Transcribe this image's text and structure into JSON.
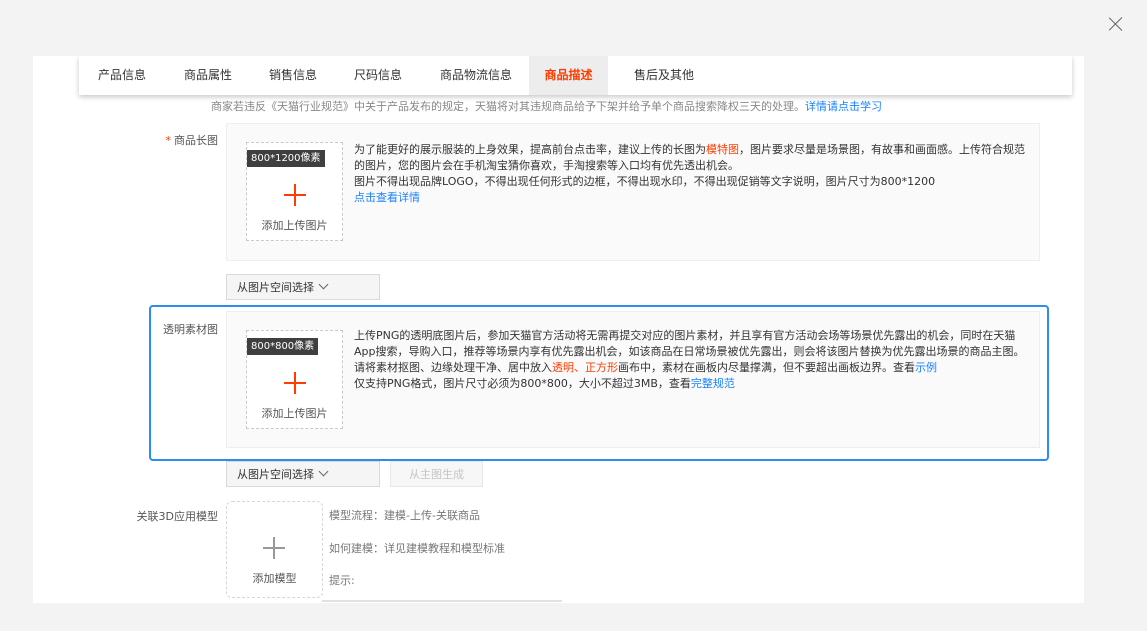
{
  "window": {
    "close_icon": "close-icon"
  },
  "tabs": [
    {
      "label": "产品信息",
      "active": false
    },
    {
      "label": "商品属性",
      "active": false
    },
    {
      "label": "销售信息",
      "active": false
    },
    {
      "label": "尺码信息",
      "active": false
    },
    {
      "label": "商品物流信息",
      "active": false
    },
    {
      "label": "商品描述",
      "active": true
    },
    {
      "label": "售后及其他",
      "active": false
    }
  ],
  "notice": {
    "text": "商家若违反《天猫行业规范》中关于产品发布的规定，天猫将对其违规商品给予下架并给予单个商品搜索降权三天的处理。",
    "link": "详情请点击学习"
  },
  "long_image": {
    "required_mark": "*",
    "label": "商品长图",
    "size_badge": "800*1200像素",
    "upload_label": "添加上传图片",
    "desc_part1": "为了能更好的展示服装的上身效果，提高前台点击率，建议上传的长图为",
    "desc_highlight": "模特图",
    "desc_part2": "，图片要求尽量是场景图，有故事和画面感。上传符合规范的图片，您的图片会在手机淘宝猜你喜欢，手淘搜索等入口均有优先透出机会。",
    "desc_line2": "图片不得出现品牌LOGO，不得出现任何形式的边框，不得出现水印，不得出现促销等文字说明，图片尺寸为800*1200",
    "details_link": "点击查看详情",
    "select_button": "从图片空间选择"
  },
  "transparent_image": {
    "label": "透明素材图",
    "size_badge": "800*800像素",
    "upload_label": "添加上传图片",
    "desc_para1": "上传PNG的透明底图片后，参加天猫官方活动将无需再提交对应的图片素材，并且享有官方活动会场等场景优先露出的机会，同时在天猫App搜索，导购入口，推荐等场景内享有优先露出机会，如该商品在日常场景被优先露出，则会将该图片替换为优先露出场景的商品主图。",
    "desc_para2_a": "请将素材抠图、边缘处理干净、居中放入",
    "desc_para2_red": "透明、正方形",
    "desc_para2_b": "画布中，素材在画板内尽量撑满，但不要超出画板边界。查看",
    "desc_para2_link": "示例",
    "desc_para3_a": "仅支持PNG格式，图片尺寸必须为800*800，大小不超过3MB，查看",
    "desc_para3_link": "完整规范",
    "select_button": "从图片空间选择",
    "generate_button": "从主图生成"
  },
  "model_3d": {
    "label": "关联3D应用模型",
    "upload_label": "添加模型",
    "line1": "模型流程：建模-上传-关联商品",
    "line2": "如何建模：详见建模教程和模型标准",
    "line3": "提示:"
  },
  "colors": {
    "accent": "#ff3d00",
    "link": "#1a82ff",
    "highlight_border": "#2d8cf0"
  }
}
